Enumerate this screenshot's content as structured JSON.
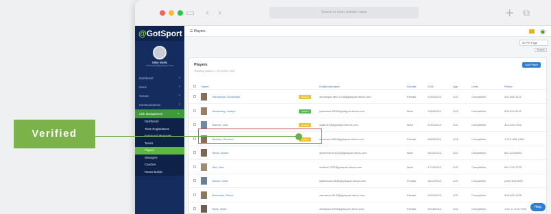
{
  "browser": {
    "url_placeholder": "Search or enter website name",
    "colors": {
      "close": "#ff5f57",
      "minimize": "#febc2e",
      "zoom": "#28c840"
    }
  },
  "sidebar": {
    "logo_g": "@",
    "logo_text": "GotSport",
    "user_name": "Mike Wells",
    "user_email": "mikewells@gotsport.com",
    "nav": [
      {
        "label": "Dashboard"
      },
      {
        "label": "Users"
      },
      {
        "label": "Venues"
      },
      {
        "label": "Communications"
      },
      {
        "label": "Club Management",
        "active": true
      }
    ],
    "sub": [
      {
        "label": "Dashboard"
      },
      {
        "label": "Team Registrations"
      },
      {
        "label": "Forms And Requests"
      },
      {
        "label": "Teams"
      },
      {
        "label": "Players",
        "active": true
      },
      {
        "label": "Managers"
      },
      {
        "label": "Coaches"
      },
      {
        "label": "Roster Builder"
      }
    ]
  },
  "topbar": {
    "title": "Players"
  },
  "controls": {
    "per_page": "50 Per Page",
    "search": "Search"
  },
  "card": {
    "title": "Players",
    "subtitle": "Showing entries 1 - 50 of 248 | 318",
    "add_button": "Add Player"
  },
  "table": {
    "headers": [
      "Name",
      "Email/Username",
      "Gender",
      "DOB",
      "Age",
      "Level",
      "Phone"
    ],
    "rows": [
      {
        "name": "Alexandria, Dominique",
        "badge": "Pending",
        "badge_color": "#e8c23a",
        "email": "dominique.alex.1234@gotsport-demo.com",
        "gender": "Female",
        "dob": "01/02/2012",
        "age": "U12",
        "level": "Competitive",
        "phone": "402-555-1312"
      },
      {
        "name": "Armstrong, Joseph",
        "badge": "Verified",
        "badge_color": "#5cb85c",
        "email": "josearmst.8234@gotsport-demo.com",
        "gender": "Male",
        "dob": "03/05/2011",
        "age": "U13",
        "level": "Competitive",
        "phone": "878-814-9118"
      },
      {
        "name": "Barnes, Lisa",
        "badge": "Pending",
        "badge_color": "#e8c23a",
        "email": "lisab.5124@gotsport-demo.com",
        "gender": "Male",
        "dob": "01/01/2012",
        "age": "U12",
        "level": "Competitive",
        "phone": "318-225-7002"
      },
      {
        "name": "Benson, Summer",
        "badge": "Verified",
        "badge_color": "#e8c23a",
        "email": "summers.5009@gotsport-demo.com",
        "gender": "Female",
        "dob": "08/08/2011",
        "age": "U13",
        "level": "Competitive",
        "phone": "1-713-680-1460"
      },
      {
        "name": "Bevin, Amber",
        "badge": "",
        "badge_color": "",
        "email": "amberbevin.4182@gotsport-demo.com",
        "gender": "Male",
        "dob": "05/23/2012",
        "age": "U12",
        "level": "Competitive",
        "phone": "861-323-6553"
      },
      {
        "name": "Bell, Nick",
        "badge": "",
        "badge_color": "",
        "email": "nickbell.7122@gotsport-demo.com",
        "gender": "Male",
        "dob": "07/10/2012",
        "age": "U12",
        "level": "Competitive",
        "phone": "651-379-7123"
      },
      {
        "name": "Bloom, Katie",
        "badge": "",
        "badge_color": "",
        "email": "katiebloom.6108@gotsport-demo.com",
        "gender": "Female",
        "dob": "06/14/2012",
        "age": "U12",
        "level": "Competitive",
        "phone": "(229) 693-6007"
      },
      {
        "name": "Brenheim, Sierra",
        "badge": "",
        "badge_color": "",
        "email": "sierrabren.5133@gotsport-demo.com",
        "gender": "Female",
        "dob": "04/02/2012",
        "age": "U12",
        "level": "Competitive",
        "phone": "518-493-1325"
      },
      {
        "name": "Byrd, Olivia",
        "badge": "",
        "badge_color": "",
        "email": "oliviabyrd.4390@gotsport-demo.com",
        "gender": "Female",
        "dob": "09/18/2012",
        "age": "U12",
        "level": "Competitive",
        "phone": "1-61-71-419-7006"
      }
    ]
  },
  "callout": {
    "label": "Verified"
  },
  "help": {
    "label": "Help"
  }
}
